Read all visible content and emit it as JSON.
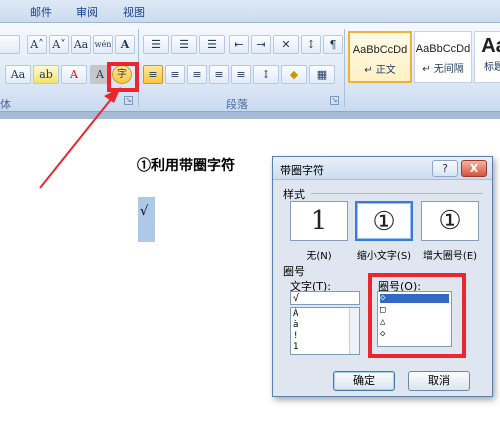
{
  "tabs": [
    "邮件",
    "审阅",
    "视图"
  ],
  "ribbon": {
    "font_row1": [
      "A˄",
      "A˅",
      "Aa",
      "wén",
      "A"
    ],
    "font_row2": [
      "Aa",
      "ab",
      "A",
      "A",
      "字"
    ],
    "paragraph_row1": [
      "☰",
      "☰",
      "☰",
      "⇤",
      "⇥",
      "✕",
      "↕",
      "¶"
    ],
    "paragraph_row2": [
      "≡",
      "≡",
      "≡",
      "≡",
      "≡",
      "↕",
      "◆",
      "▦"
    ],
    "group_font_label": "体",
    "group_paragraph_label": "段落",
    "styles": [
      {
        "sample": "AaBbCcDd",
        "name": "↵ 正文"
      },
      {
        "sample": "AaBbCcDd",
        "name": "↵ 无间隔"
      },
      {
        "sample": "Aa",
        "name": "标题"
      }
    ]
  },
  "document": {
    "heading": "①利用带圈字符",
    "selected_char": "√"
  },
  "dialog": {
    "title": "带圈字符",
    "help": "?",
    "close": "X",
    "style_label": "样式",
    "style_options": [
      {
        "glyph": "1",
        "label": "无(N)"
      },
      {
        "glyph": "①",
        "label": "缩小文字(S)"
      },
      {
        "glyph": "①",
        "label": "增大圈号(E)"
      }
    ],
    "enclosure_label": "圈号",
    "text_label": "文字(T):",
    "text_value": "√",
    "text_list": [
      "À",
      "à",
      "!",
      "1"
    ],
    "circle_label": "圈号(O):",
    "circle_list": [
      "◇",
      "□",
      "△",
      "◇"
    ],
    "ok": "确定",
    "cancel": "取消"
  }
}
